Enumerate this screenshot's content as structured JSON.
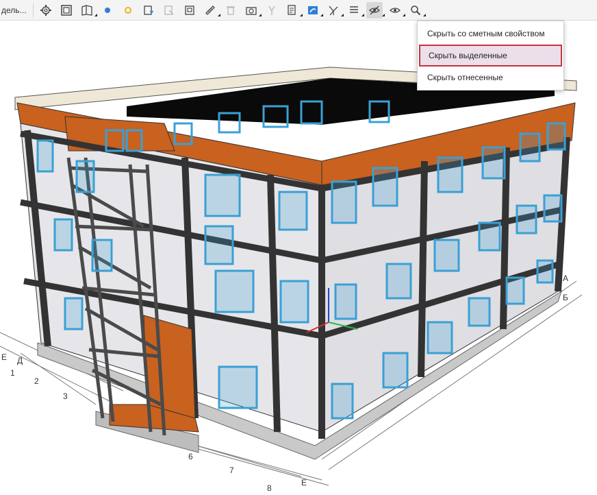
{
  "toolbar": {
    "model_label": "дель...",
    "buttons": [
      {
        "icon": "settings-gear-icon"
      },
      {
        "icon": "frame-view-icon"
      },
      {
        "icon": "section-plane-icon"
      },
      {
        "icon": "blue-dot-icon"
      },
      {
        "icon": "yellow-dot-icon"
      },
      {
        "icon": "add-object-icon"
      },
      {
        "icon": "object-disabled-icon"
      },
      {
        "icon": "save-view-icon"
      },
      {
        "icon": "measure-ruler-icon"
      },
      {
        "icon": "delete-icon"
      },
      {
        "icon": "camera-icon"
      },
      {
        "icon": "pin-disabled-icon"
      },
      {
        "icon": "report-icon"
      },
      {
        "icon": "color-palette-icon"
      },
      {
        "icon": "axes-icon"
      },
      {
        "icon": "list-icon"
      },
      {
        "icon": "hide-eye-icon"
      },
      {
        "icon": "show-eye-icon"
      },
      {
        "icon": "search-zoom-icon"
      }
    ]
  },
  "hide_menu": {
    "items": [
      {
        "label": "Скрыть со сметным свойством",
        "highlighted": false
      },
      {
        "label": "Скрыть выделенные",
        "highlighted": true
      },
      {
        "label": "Скрыть отнесенные",
        "highlighted": false
      }
    ]
  },
  "grid_axes": {
    "left_labels": [
      "Е",
      "Д",
      "1",
      "2",
      "3"
    ],
    "bottom_labels": [
      "6",
      "7",
      "8",
      "Е"
    ],
    "right_labels": [
      "А",
      "Б"
    ]
  },
  "colors": {
    "accent_orange": "#c9611f",
    "window_blue": "#3aa0d4",
    "wall_light": "#e8e8ec",
    "frame_dark": "#333333",
    "menu_highlight_border": "#c8323a"
  }
}
